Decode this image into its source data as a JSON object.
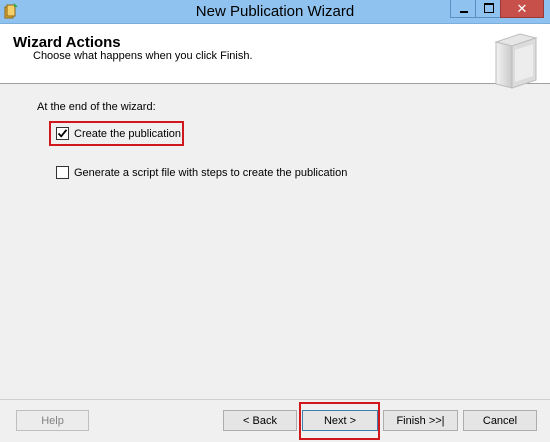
{
  "window": {
    "title": "New Publication Wizard",
    "close_glyph": "✕"
  },
  "header": {
    "title": "Wizard Actions",
    "subtitle": "Choose what happens when you click Finish."
  },
  "content": {
    "intro": "At the end of the wizard:",
    "options": [
      {
        "label": "Create the publication",
        "checked": true
      },
      {
        "label": "Generate a script file with steps to create the publication",
        "checked": false
      }
    ]
  },
  "buttons": {
    "help": "Help",
    "back": "< Back",
    "next": "Next >",
    "finish": "Finish >>|",
    "cancel": "Cancel"
  },
  "colors": {
    "titlebar": "#8fc2ee",
    "highlight": "#d0171b",
    "close_button": "#c7504a"
  }
}
